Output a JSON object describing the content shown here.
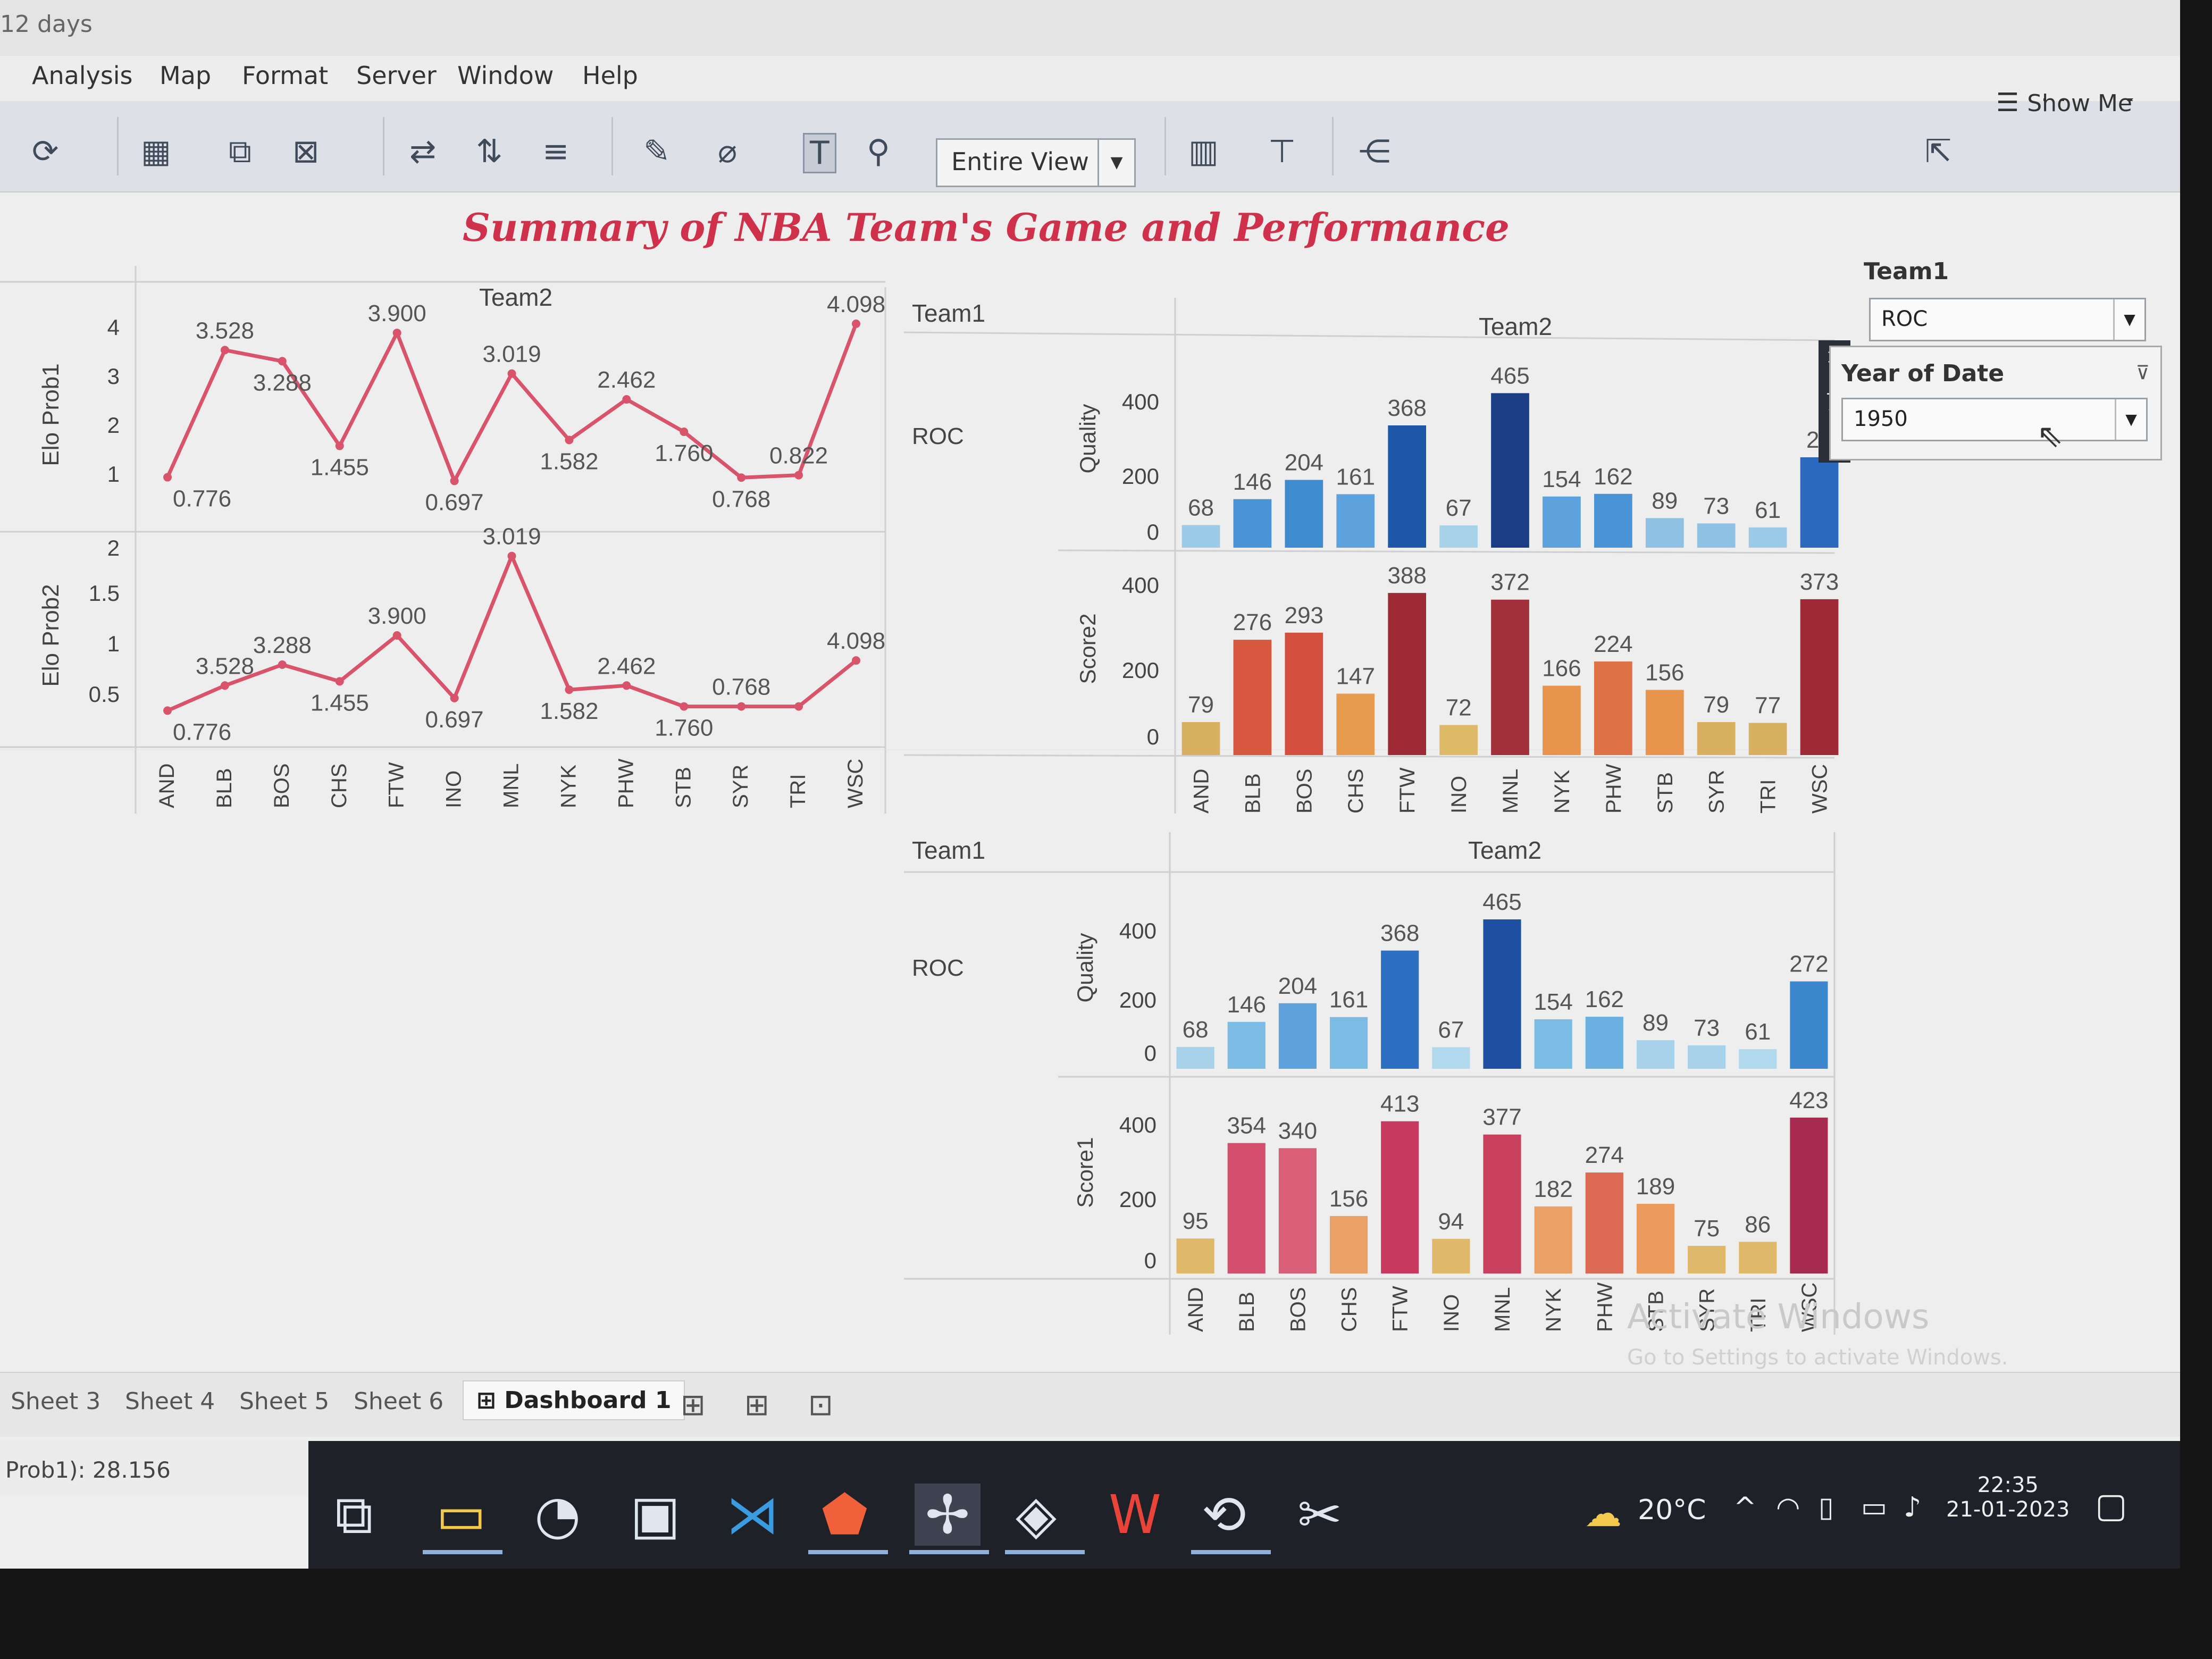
{
  "titlebar": {
    "text": "12 days"
  },
  "menu": [
    "Analysis",
    "Map",
    "Format",
    "Server",
    "Window",
    "Help"
  ],
  "toolbar": {
    "view_select": "Entire View",
    "show_me": "Show Me"
  },
  "dashboard_title": "Summary of NBA Team's Game and Performance",
  "filters": {
    "team1_label": "Team1",
    "team1_value": "ROC",
    "year_label": "Year of Date",
    "year_value": "1950"
  },
  "left_chart": {
    "header": "Team2",
    "ylabel_top": "Elo Prob1",
    "ylabel_bottom": "Elo Prob2",
    "top_ticks": [
      "4",
      "3",
      "2",
      "1"
    ],
    "bottom_ticks": [
      "2",
      "1.5",
      "1",
      "0.5"
    ]
  },
  "right_top": {
    "team1_header": "Team1",
    "team2_header": "Team2",
    "row_label": "ROC",
    "ylabel_top": "Quality",
    "ylabel_bottom": "Score2"
  },
  "right_bottom": {
    "team1_header": "Team1",
    "team2_header": "Team2",
    "row_label": "ROC",
    "ylabel_top": "Quality",
    "ylabel_bottom": "Score1"
  },
  "bar_ticks": [
    "400",
    "200",
    "0"
  ],
  "chart_data": [
    {
      "type": "line",
      "title": "",
      "categories": [
        "AND",
        "BLB",
        "BOS",
        "CHS",
        "FTW",
        "INO",
        "MNL",
        "NYK",
        "PHW",
        "STB",
        "SYR",
        "TRI",
        "WSC"
      ],
      "series": [
        {
          "name": "Elo Prob1",
          "values": [
            0.776,
            3.528,
            3.288,
            1.455,
            3.9,
            0.697,
            3.019,
            1.582,
            2.462,
            1.76,
            0.768,
            0.822,
            4.098
          ]
        }
      ],
      "labels": [
        "0.776",
        "3.528",
        "3.288",
        "1.455",
        "3.900",
        "0.697",
        "3.019",
        "1.582",
        "2.462",
        "1.760",
        "0.768",
        "0.822",
        "4.098"
      ],
      "xlabel": "Team2",
      "ylabel": "Elo Prob1",
      "ylim": [
        0,
        4.2
      ],
      "color": "#d9546b"
    },
    {
      "type": "line",
      "title": "",
      "categories": [
        "AND",
        "BLB",
        "BOS",
        "CHS",
        "FTW",
        "INO",
        "MNL",
        "NYK",
        "PHW",
        "STB",
        "SYR",
        "TRI",
        "WSC"
      ],
      "series": [
        {
          "name": "Elo Prob2",
          "values": [
            0.15,
            0.45,
            0.7,
            0.5,
            1.05,
            0.3,
            2.0,
            0.4,
            0.45,
            0.2,
            0.2,
            0.2,
            0.75
          ]
        }
      ],
      "labels": [
        "0.776",
        "3.528",
        "3.288",
        "1.455",
        "3.900",
        "0.697",
        "3.019",
        "1.582",
        "2.462",
        "1.760",
        "0.768",
        "",
        "4.098"
      ],
      "ylabel": "Elo Prob2",
      "ylim": [
        0,
        2.1
      ],
      "color": "#d9546b"
    },
    {
      "type": "bar",
      "categories": [
        "AND",
        "BLB",
        "BOS",
        "CHS",
        "FTW",
        "INO",
        "MNL",
        "NYK",
        "PHW",
        "STB",
        "SYR",
        "TRI",
        "WSC"
      ],
      "series": [
        {
          "name": "Quality",
          "values": [
            68,
            146,
            204,
            161,
            368,
            67,
            465,
            154,
            162,
            89,
            73,
            61,
            272
          ]
        }
      ],
      "labels": [
        "68",
        "146",
        "204",
        "161",
        "368",
        "67",
        "465",
        "154",
        "162",
        "89",
        "73",
        "61",
        "27"
      ],
      "ylabel": "Quality",
      "ylim": [
        0,
        480
      ],
      "colors": [
        "#9ccbe8",
        "#4a93d6",
        "#3f8bd0",
        "#5ea2dd",
        "#1e56a8",
        "#a8d2ea",
        "#1a3d86",
        "#5ea2dd",
        "#4a93d6",
        "#8ec1e4",
        "#8ec1e4",
        "#9ccbe8",
        "#2a69bd"
      ]
    },
    {
      "type": "bar",
      "categories": [
        "AND",
        "BLB",
        "BOS",
        "CHS",
        "FTW",
        "INO",
        "MNL",
        "NYK",
        "PHW",
        "STB",
        "SYR",
        "TRI",
        "WSC"
      ],
      "series": [
        {
          "name": "Score2",
          "values": [
            79,
            276,
            293,
            147,
            388,
            72,
            372,
            166,
            224,
            156,
            79,
            77,
            373
          ]
        }
      ],
      "labels": [
        "79",
        "276",
        "293",
        "147",
        "388",
        "72",
        "372",
        "166",
        "224",
        "156",
        "79",
        "77",
        "373"
      ],
      "ylabel": "Score2",
      "ylim": [
        0,
        420
      ],
      "colors": [
        "#d9b060",
        "#d7573f",
        "#d44e3e",
        "#e69b4e",
        "#9e2a35",
        "#dfba66",
        "#a2303a",
        "#e8944c",
        "#de7145",
        "#e8944c",
        "#d9b060",
        "#d9b060",
        "#9e2a35"
      ]
    },
    {
      "type": "bar",
      "categories": [
        "AND",
        "BLB",
        "BOS",
        "CHS",
        "FTW",
        "INO",
        "MNL",
        "NYK",
        "PHW",
        "STB",
        "SYR",
        "TRI",
        "WSC"
      ],
      "series": [
        {
          "name": "Quality",
          "values": [
            68,
            146,
            204,
            161,
            368,
            67,
            465,
            154,
            162,
            89,
            73,
            61,
            272
          ]
        }
      ],
      "labels": [
        "68",
        "146",
        "204",
        "161",
        "368",
        "67",
        "465",
        "154",
        "162",
        "89",
        "73",
        "61",
        "272"
      ],
      "ylabel": "Quality",
      "ylim": [
        0,
        480
      ],
      "colors": [
        "#a8d2ea",
        "#7cbbe3",
        "#5ea2dd",
        "#7cbbe3",
        "#2d6fc0",
        "#b1d8ec",
        "#1e4fa0",
        "#7cbbe3",
        "#6bb0e0",
        "#a8d2ea",
        "#a8d2ea",
        "#b1d8ec",
        "#3b86cc"
      ]
    },
    {
      "type": "bar",
      "categories": [
        "AND",
        "BLB",
        "BOS",
        "CHS",
        "FTW",
        "INO",
        "MNL",
        "NYK",
        "PHW",
        "STB",
        "SYR",
        "TRI",
        "WSC"
      ],
      "series": [
        {
          "name": "Score1",
          "values": [
            95,
            354,
            340,
            156,
            413,
            94,
            377,
            182,
            274,
            189,
            75,
            86,
            423
          ]
        }
      ],
      "labels": [
        "95",
        "354",
        "340",
        "156",
        "413",
        "94",
        "377",
        "182",
        "274",
        "189",
        "75",
        "86",
        "423"
      ],
      "ylabel": "Score1",
      "ylim": [
        0,
        440
      ],
      "colors": [
        "#e0b86a",
        "#d44f6e",
        "#da5f78",
        "#eba066",
        "#c8385f",
        "#e0b86a",
        "#c9405f",
        "#eba066",
        "#dd6a55",
        "#eb9b5d",
        "#e0b86a",
        "#e0b86a",
        "#a72a50"
      ]
    }
  ],
  "tabs": [
    "Sheet 3",
    "Sheet 4",
    "Sheet 5",
    "Sheet 6",
    "Dashboard 1"
  ],
  "status_text": "Prob1): 28.156",
  "watermark": {
    "line1": "Activate Windows",
    "line2": "Go to Settings to activate Windows."
  },
  "system": {
    "temp": "20°C",
    "time": "22:35",
    "date": "21-01-2023"
  }
}
